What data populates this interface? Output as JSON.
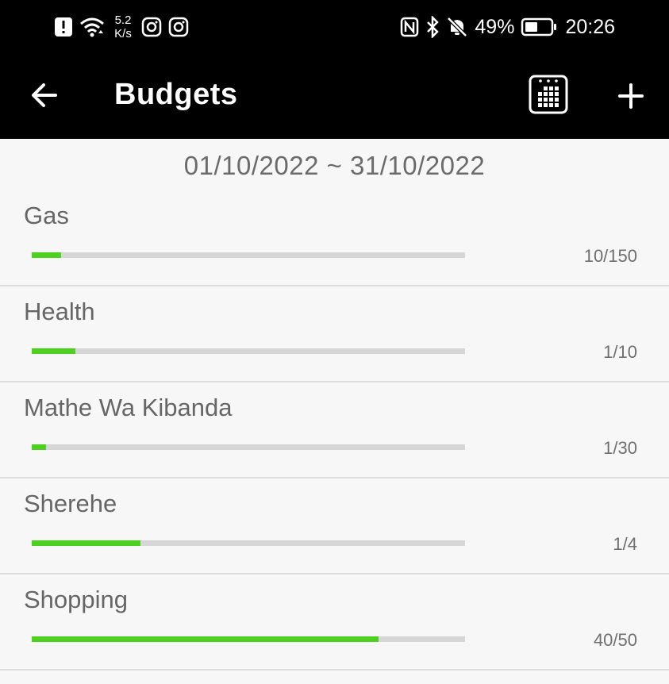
{
  "status_bar": {
    "speed_value": "5.2",
    "speed_unit": "K/s",
    "battery": "49%",
    "time": "20:26",
    "icons_left": [
      "alert-icon",
      "wifi-icon",
      "instagram-icon",
      "instagram-icon"
    ],
    "icons_right": [
      "nfc-icon",
      "bluetooth-icon",
      "bell-muted-icon",
      "battery-icon"
    ]
  },
  "appbar": {
    "title": "Budgets",
    "back_icon": "arrow-left-icon",
    "calendar_icon": "calendar-icon",
    "add_icon": "plus-icon"
  },
  "date_range": "01/10/2022 ~ 31/10/2022",
  "colors": {
    "bar_fill": "#4ed021",
    "bar_track": "#d6d6d6",
    "appbar_bg": "#000000"
  },
  "budgets": [
    {
      "name": "Gas",
      "value_label": "10/150",
      "progress": 0.067
    },
    {
      "name": "Health",
      "value_label": "1/10",
      "progress": 0.1
    },
    {
      "name": "Mathe Wa Kibanda",
      "value_label": "1/30",
      "progress": 0.033
    },
    {
      "name": "Sherehe",
      "value_label": "1/4",
      "progress": 0.25
    },
    {
      "name": "Shopping",
      "value_label": "40/50",
      "progress": 0.8
    }
  ]
}
